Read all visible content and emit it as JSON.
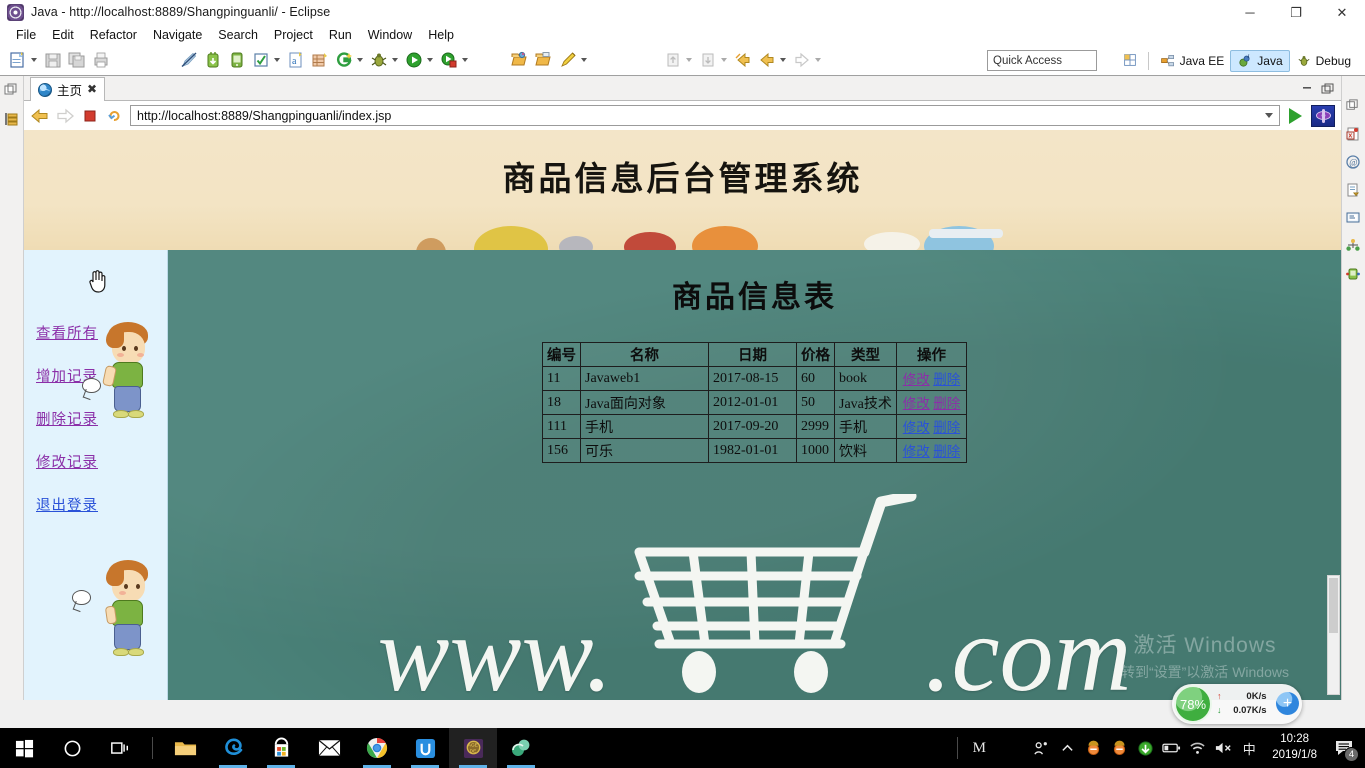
{
  "window": {
    "title": "Java - http://localhost:8889/Shangpinguanli/ - Eclipse",
    "app_icon": "eclipse-icon",
    "minimize": "─",
    "maximize": "❐",
    "close": "✕"
  },
  "menu": [
    "File",
    "Edit",
    "Refactor",
    "Navigate",
    "Search",
    "Project",
    "Run",
    "Window",
    "Help"
  ],
  "toolbar": {
    "quick_access": "Quick Access",
    "perspectives": [
      {
        "label": "Java EE",
        "active": false
      },
      {
        "label": "Java",
        "active": true
      },
      {
        "label": "Debug",
        "active": false
      }
    ]
  },
  "editor": {
    "tab_label": "主页",
    "tab_close": "✖"
  },
  "browser": {
    "url": "http://localhost:8889/Shangpinguanli/index.jsp"
  },
  "webpage": {
    "banner_title": "商品信息后台管理系统",
    "content_title": "商品信息表",
    "sidebar_links": [
      {
        "label": "查看所有",
        "state": "visited"
      },
      {
        "label": "增加记录",
        "state": "visited"
      },
      {
        "label": "删除记录",
        "state": "visited"
      },
      {
        "label": "修改记录",
        "state": "visited"
      },
      {
        "label": "退出登录",
        "state": "fresh"
      }
    ],
    "table": {
      "headers": [
        "编号",
        "名称",
        "日期",
        "价格",
        "类型",
        "操作"
      ],
      "rows": [
        {
          "id": "11",
          "name": "Javaweb1",
          "date": "2017-08-15",
          "price": "60",
          "type": "book",
          "edit": "修改",
          "edit_state": "visited",
          "del": "删除",
          "del_state": "fresh"
        },
        {
          "id": "18",
          "name": "Java面向对象",
          "date": "2012-01-01",
          "price": "50",
          "type": "Java技术",
          "edit": "修改",
          "edit_state": "visited",
          "del": "删除",
          "del_state": "visited"
        },
        {
          "id": "111",
          "name": "手机",
          "date": "2017-09-20",
          "price": "2999",
          "type": "手机",
          "edit": "修改",
          "edit_state": "fresh",
          "del": "删除",
          "del_state": "fresh"
        },
        {
          "id": "156",
          "name": "可乐",
          "date": "1982-01-01",
          "price": "1000",
          "type": "饮料",
          "edit": "修改",
          "edit_state": "fresh",
          "del": "删除",
          "del_state": "fresh"
        }
      ]
    },
    "chalk_left": "www.",
    "chalk_right": ".com",
    "cart_icon": "shopping-cart-icon"
  },
  "watermark": {
    "line1": "激活 Windows",
    "line2": "转到“设置”以激活 Windows"
  },
  "net_widget": {
    "percent": "78%",
    "up": "0K/s",
    "down": "0.07K/s",
    "up_arrow": "↑",
    "down_arrow": "↓",
    "plus": "+"
  },
  "taskbar": {
    "time": "10:28",
    "date": "2019/1/8",
    "notification_count": "4",
    "ime": "中",
    "items": [
      {
        "name": "start-button",
        "icon": "windows-logo-icon"
      },
      {
        "name": "cortana-button",
        "icon": "circle-icon"
      },
      {
        "name": "task-view-button",
        "icon": "task-view-icon"
      },
      {
        "name": "file-explorer",
        "icon": "folder-icon"
      },
      {
        "name": "edge-browser",
        "icon": "edge-icon"
      },
      {
        "name": "microsoft-store",
        "icon": "store-icon"
      },
      {
        "name": "mail-app",
        "icon": "mail-icon"
      },
      {
        "name": "chrome-browser",
        "icon": "chrome-icon"
      },
      {
        "name": "uu-app",
        "icon": "u-icon"
      },
      {
        "name": "age-of-empires",
        "icon": "game-icon"
      },
      {
        "name": "eclipse-app",
        "icon": "eclipse-icon"
      }
    ],
    "tray": [
      "M",
      "people-icon",
      "chevron-up-icon",
      "security-icon-1",
      "security-icon-2",
      "update-icon",
      "battery-icon",
      "wifi-icon",
      "volume-muted-icon"
    ]
  },
  "colors": {
    "banner_bg": "#f3e4c4",
    "content_bg": "#4a8279",
    "sidebar_bg": "#e2f3fd",
    "link_visited": "#8b2fa8",
    "link_fresh": "#2a52d8",
    "accent_blue": "#cde8ff",
    "taskbar_bg": "#000000"
  }
}
